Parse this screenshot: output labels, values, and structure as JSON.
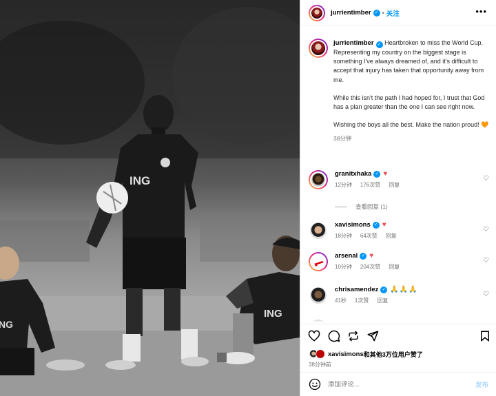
{
  "post": {
    "author": "jurrientimber",
    "follow_label": "关注",
    "more_icon": "more-horizontal-icon",
    "caption_paragraphs": [
      "Heartbroken to miss the World Cup. Representing my country on the biggest stage is something I've always dreamed of, and it's difficult to accept that injury has taken that opportunity away from me.",
      "While this isn't the path I had hoped for, I trust that God has a plan greater than the one I can see right now.",
      "Wishing the boys all the best. Make the nation proud!"
    ],
    "caption_emoji": "🧡",
    "caption_time": "38分钟"
  },
  "photo": {
    "ing_left": "ING",
    "ing_right": "ING"
  },
  "comments": [
    {
      "user": "granitxhaka",
      "text": "♥",
      "time": "12分钟",
      "likes": "176次赞",
      "reply": "回复"
    },
    {
      "user": "xavisimons",
      "text": "♥",
      "time": "18分钟",
      "likes": "64次赞",
      "reply": "回复"
    },
    {
      "user": "arsenal",
      "text": "♥",
      "time": "10分钟",
      "likes": "204次赞",
      "reply": "回复"
    },
    {
      "user": "chrisamendez",
      "text": "🙏🙏🙏",
      "time": "41秒",
      "likes": "1次赞",
      "reply": "回复"
    }
  ],
  "view_replies": "查看回复 (1)",
  "likes_line": {
    "user": "xavisimons",
    "rest": "和其他3万位用户赞了"
  },
  "posted_ago": "38分钟前",
  "composer": {
    "placeholder": "添加评论...",
    "post_label": "发布"
  },
  "colors": {
    "accent": "#0095f6",
    "heart": "#ed4956",
    "muted": "#737373",
    "post_disabled": "#b3dbff"
  }
}
